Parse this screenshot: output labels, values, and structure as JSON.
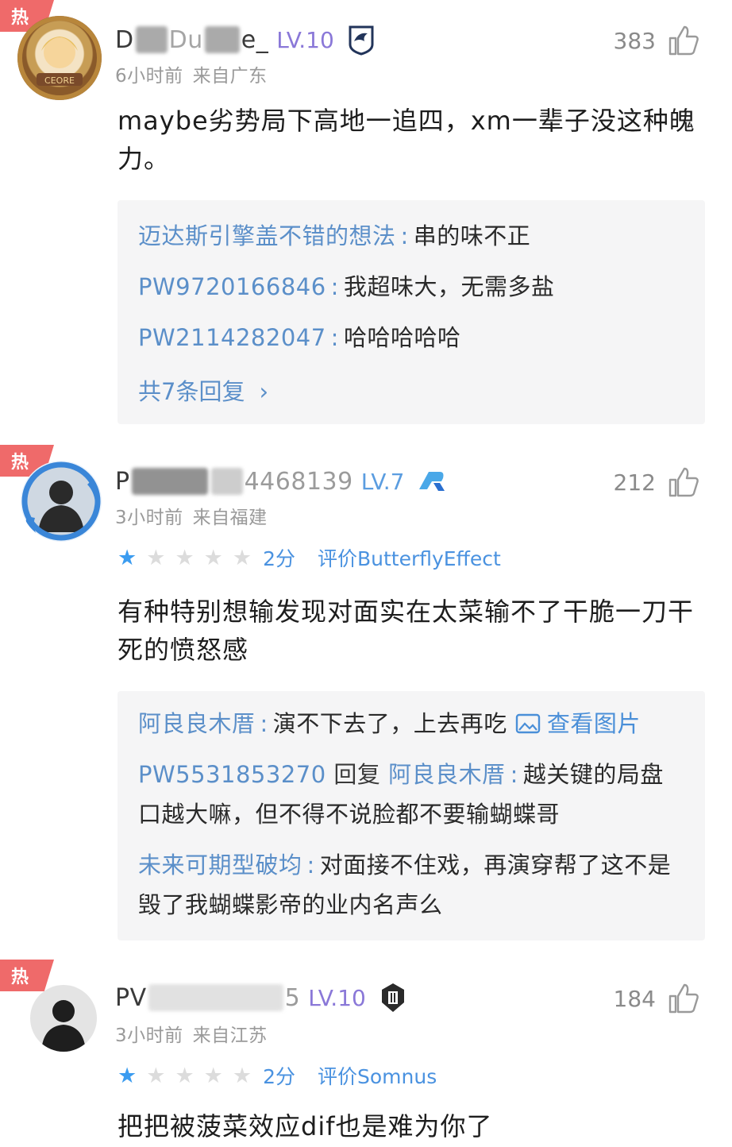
{
  "comments": [
    {
      "hot": "热",
      "username_start": "D",
      "username_mid": "Du",
      "username_end": "e_",
      "level": "LV.10",
      "time": "6小时前",
      "location": "来自广东",
      "likes": "383",
      "avatar_text": "CEORE",
      "text": "maybe劣势局下高地一追四，xm一辈子没这种魄力。",
      "replies": [
        {
          "user": "迈达斯引擎盖不错的想法",
          "text": "串的味不正"
        },
        {
          "user": "PW9720166846",
          "text": "我超味大，无需多盐"
        },
        {
          "user": "PW2114282047",
          "text": "哈哈哈哈哈"
        }
      ],
      "more_label": "共7条回复",
      "more_chevron": "›"
    },
    {
      "hot": "热",
      "username_start": "P",
      "username_end": "4468139",
      "level": "LV.7",
      "time": "3小时前",
      "location": "来自福建",
      "likes": "212",
      "rating_score": "2分",
      "rating_target": "评价ButterflyEffect",
      "stars_filled": 1,
      "stars_total": 5,
      "text": "有种特别想输发现对面实在太菜输不了干脆一刀干死的愤怒感",
      "replies": [
        {
          "user": "阿良良木厝",
          "text": "演不下去了，上去再吃",
          "view_image": "查看图片"
        },
        {
          "user": "PW5531853270",
          "reply_word": "回复",
          "reply_to": "阿良良木厝",
          "text": "越关键的局盘口越大嘛，但不得不说脸都不要输蝴蝶哥"
        },
        {
          "user": "未来可期型破均",
          "text": "对面接不住戏，再演穿帮了这不是毁了我蝴蝶影帝的业内名声么"
        }
      ]
    },
    {
      "hot": "热",
      "username_start": "PV",
      "username_end": "5",
      "level": "LV.10",
      "time": "3小时前",
      "location": "来自江苏",
      "likes": "184",
      "rating_score": "2分",
      "rating_target": "评价Somnus",
      "stars_filled": 1,
      "stars_total": 5,
      "text": "把把被菠菜效应dif也是难为你了"
    }
  ],
  "icons": {
    "like": "thumbs-up-icon",
    "star": "star-icon",
    "picture": "picture-icon"
  },
  "colors": {
    "hot_tag": "#ef6a6a",
    "level": "#8a78d8",
    "link": "#5b8fc9",
    "star_on": "#3b9cf0",
    "star_off": "#dcdcdc"
  }
}
